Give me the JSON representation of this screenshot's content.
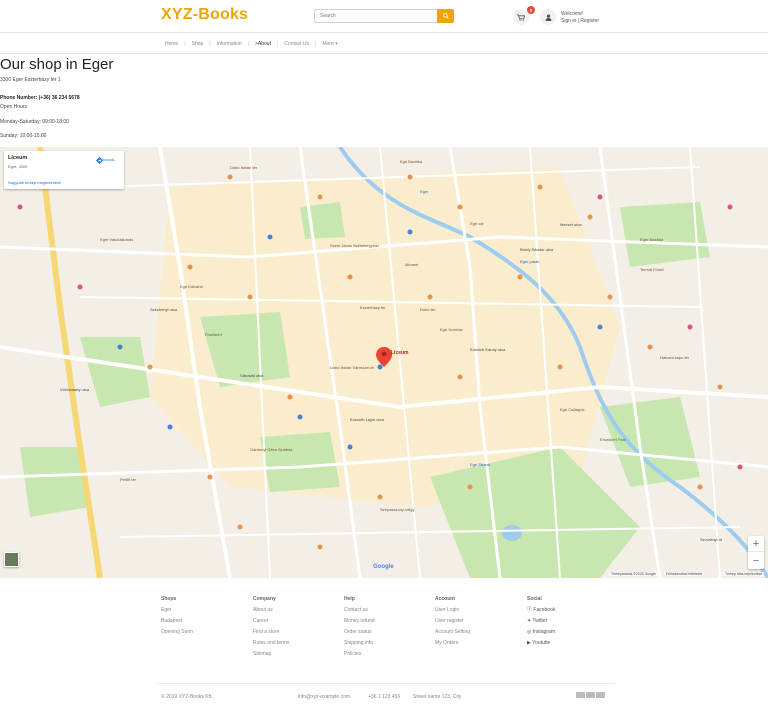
{
  "header": {
    "brand": "XYZ-Books",
    "search_placeholder": "Search",
    "cart_count": "0",
    "welcome": "Welcome!",
    "auth_links": "Sign in | Register",
    "colors": {
      "brand": "#f0a500",
      "badge": "#e14b3b"
    }
  },
  "nav": {
    "items": [
      "Home",
      "Shop",
      "Information",
      "About",
      "Contact Us",
      "More"
    ],
    "active": "About"
  },
  "page": {
    "title": "Our shop in Eger",
    "address": "3300 Eger Eszterházy tér 1",
    "phone_label": "Phone Number:",
    "phone": "(+36) 36 234 5678",
    "hours_label": "Open Hours",
    "hours_weekdays": "Monday-Saturday: 09:00-18:00",
    "hours_sunday": "Sunday: 10:00-15:00"
  },
  "map": {
    "card_name": "Líceum",
    "card_addr": "Eger, 3300",
    "card_larger": "Nagyobb térkép megtekintése",
    "card_directions": "Útvonal...",
    "pin_label": "Líceum",
    "zoom_in": "+",
    "zoom_out": "−",
    "google": "Google",
    "attrib_1": "Térképadatok ©2020 Google",
    "attrib_2": "Felhasználási feltételek",
    "attrib_3": "Térkép hiba bejelentése",
    "labels": [
      "Dobó István tér",
      "Egri Bazilika",
      "Líceum",
      "Eger",
      "Egri vár",
      "Szent János Székesegyház",
      "Minaret",
      "Érsekkert",
      "Egri Kálvária",
      "Eszterházy tér",
      "Dobó tér",
      "Egri Színház",
      "Eger patak",
      "Termál Fürdő",
      "Egri Csillagok",
      "Hatvani kapu tér",
      "Szépasszony-völgy",
      "Gárdonyi Géza Színház",
      "Eger Bazilika",
      "Bródy Sándor utca",
      "Mecset utca",
      "Városfal utca",
      "Dobó István Vármúzeum",
      "Eger Vasútállomás",
      "Kossuth Lajos utca",
      "Széchenyi utca",
      "Knézich Károly utca",
      "Érsekkert Park",
      "Egri Strand",
      "Petőfi tér",
      "Vörösmarty utca",
      "Szvorényi út"
    ]
  },
  "footer": {
    "columns": [
      {
        "head": "Shops",
        "links": [
          "Eger",
          "Budapest",
          "Opening Soon"
        ]
      },
      {
        "head": "Company",
        "links": [
          "About us",
          "Career",
          "Find a store",
          "Rules and terms",
          "Sitemap"
        ]
      },
      {
        "head": "Help",
        "links": [
          "Contact us",
          "Money refund",
          "Order status",
          "Shipping info",
          "Policies"
        ]
      },
      {
        "head": "Account",
        "links": [
          "User Login",
          "User register",
          "Account Setting",
          "My Orders"
        ]
      },
      {
        "head": "Social",
        "links": [
          "Facebook",
          "Twitter",
          "Instagram",
          "Youtube"
        ]
      }
    ],
    "copyright": "© 2019 XYZ-Books Kft.",
    "email": "info@xyz-example.com",
    "phone": "+36 1 123 456",
    "street": "Street name 123, City"
  }
}
